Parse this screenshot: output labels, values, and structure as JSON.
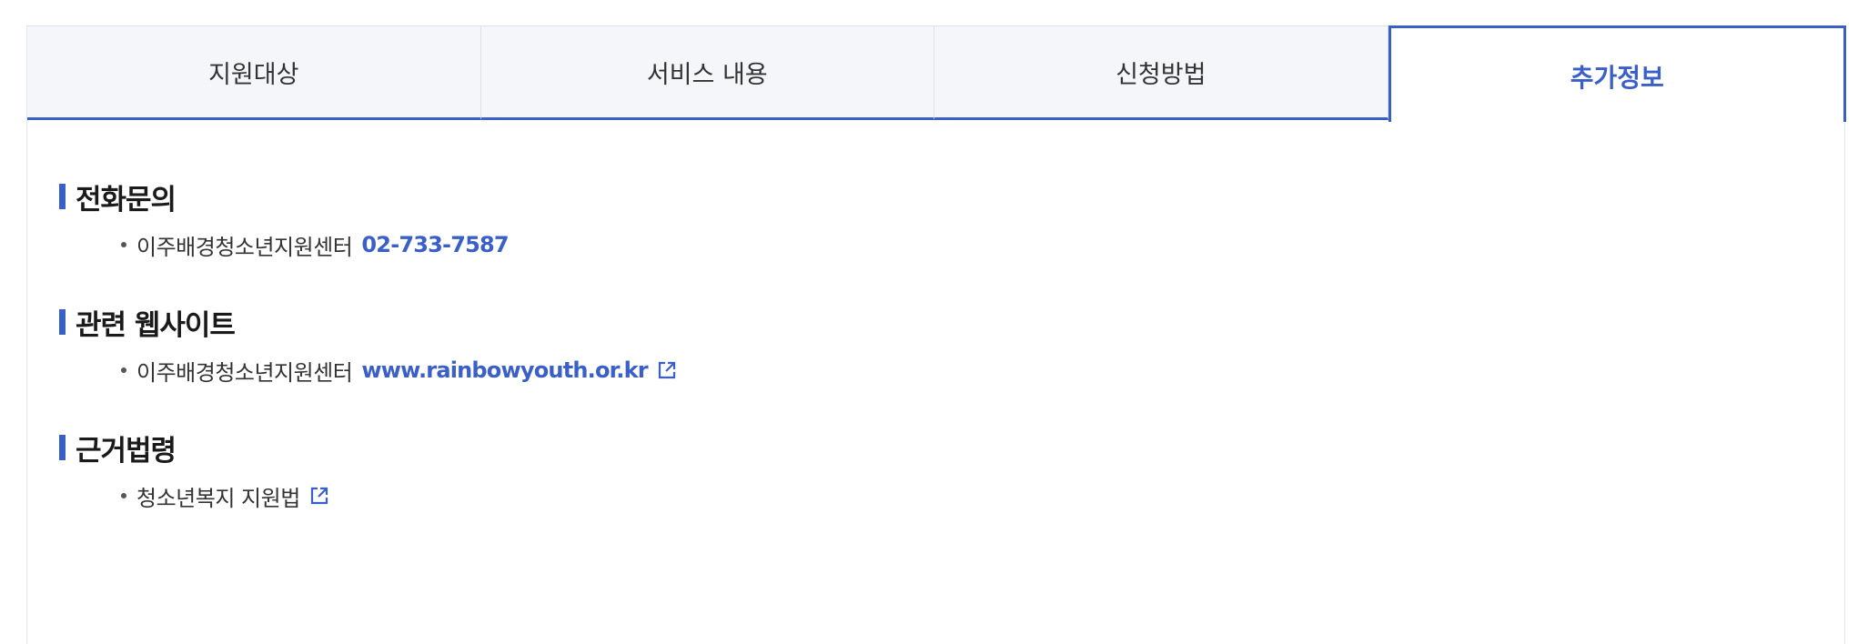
{
  "tabs": [
    {
      "label": "지원대상",
      "active": false
    },
    {
      "label": "서비스 내용",
      "active": false
    },
    {
      "label": "신청방법",
      "active": false
    },
    {
      "label": "추가정보",
      "active": true
    }
  ],
  "sections": {
    "phone": {
      "title": "전화문의",
      "items": [
        {
          "text": "이주배경청소년지원센터",
          "link": "02-733-7587"
        }
      ]
    },
    "website": {
      "title": "관련 웹사이트",
      "items": [
        {
          "text": "이주배경청소년지원센터",
          "link": "www.rainbowyouth.or.kr",
          "icon": "external-link-icon"
        }
      ]
    },
    "law": {
      "title": "근거법령",
      "items": [
        {
          "text": "청소년복지 지원법",
          "icon": "external-link-icon"
        }
      ]
    }
  },
  "colors": {
    "accent": "#3a5fc9",
    "tab_bg": "#f4f6f9",
    "text": "#333333"
  }
}
